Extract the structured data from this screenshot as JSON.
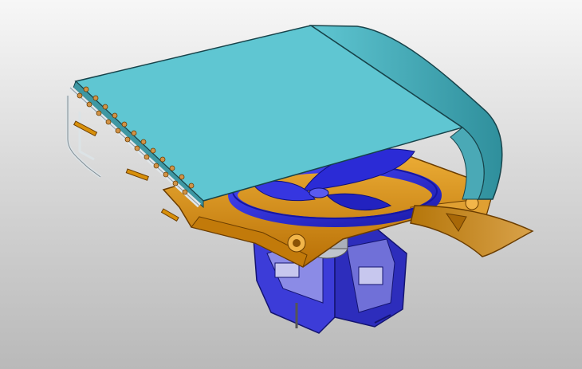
{
  "viewport": {
    "background_top": "#f7f7f7",
    "background_bottom": "#b9b9b9"
  },
  "model": {
    "parts": [
      {
        "name": "coil-panel",
        "color": "#5fc6d2"
      },
      {
        "name": "fan-housing",
        "color": "#d8900a"
      },
      {
        "name": "fan-blades",
        "color": "#2a2ae0"
      },
      {
        "name": "motor-mount-frame",
        "color": "#3a3ad8"
      },
      {
        "name": "copper-tubes",
        "color": "#c98a3a"
      },
      {
        "name": "outlet-flap",
        "color": "#c8920f"
      }
    ]
  }
}
